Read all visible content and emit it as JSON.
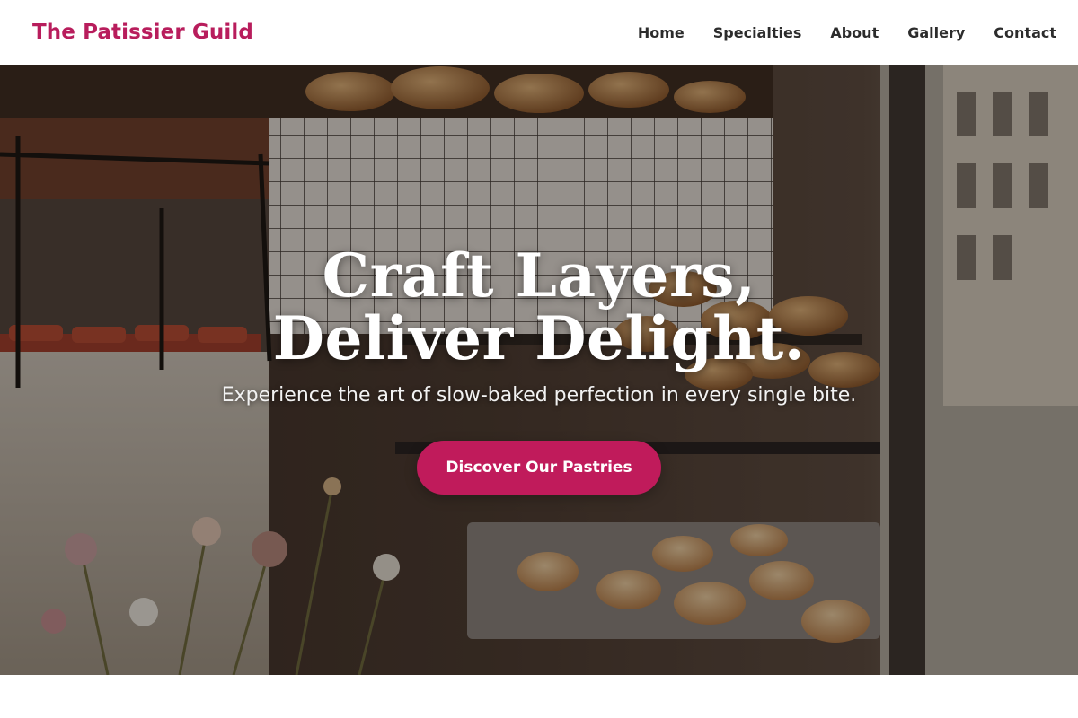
{
  "site": {
    "brand": "The Patissier Guild",
    "brand_color": "#b81d5c"
  },
  "nav": {
    "items": [
      {
        "label": "Home"
      },
      {
        "label": "Specialties"
      },
      {
        "label": "About"
      },
      {
        "label": "Gallery"
      },
      {
        "label": "Contact"
      }
    ]
  },
  "hero": {
    "title": "Craft Layers, Deliver Delight.",
    "subtitle": "Experience the art of slow-baked perfection in every single bite.",
    "cta_label": "Discover Our Pastries",
    "cta_color": "#c01b5b",
    "background": "bakery-display-window-photo"
  }
}
